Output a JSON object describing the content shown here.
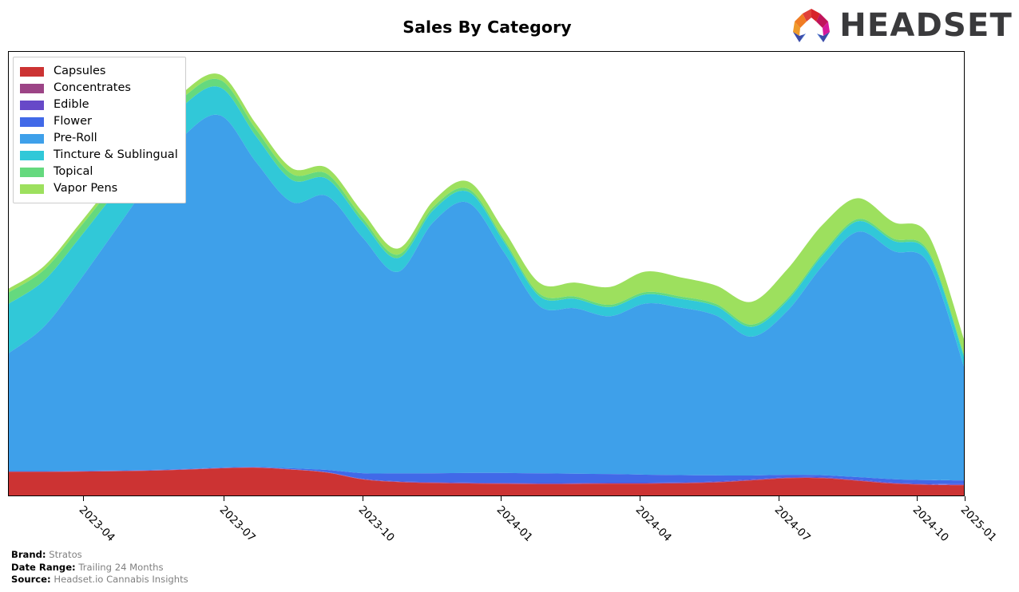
{
  "header": {
    "title": "Sales By Category",
    "logo_word": "HEADSET",
    "logo_colors": {
      "orange": "#f07c23",
      "red": "#d8232a",
      "crimson": "#c0145a",
      "magenta": "#d6189b",
      "indigo": "#3b4ba8",
      "blue": "#2b5fc4",
      "wordmark": "#3a3a3c"
    }
  },
  "legend": {
    "items": [
      {
        "label": "Capsules",
        "color": "#cc3333"
      },
      {
        "label": "Concentrates",
        "color": "#9c4486"
      },
      {
        "label": "Edible",
        "color": "#6749c8"
      },
      {
        "label": "Flower",
        "color": "#4169e8"
      },
      {
        "label": "Pre-Roll",
        "color": "#3ea0ea"
      },
      {
        "label": "Tincture & Sublingual",
        "color": "#31c8d8"
      },
      {
        "label": "Topical",
        "color": "#65d97e"
      },
      {
        "label": "Vapor Pens",
        "color": "#9de05e"
      }
    ]
  },
  "footer": {
    "rows": [
      {
        "key": "Brand:",
        "value": "Stratos"
      },
      {
        "key": "Date Range:",
        "value": "Trailing 24 Months"
      },
      {
        "key": "Source:",
        "value": "Headset.io Cannabis Insights"
      }
    ]
  },
  "chart_data": {
    "type": "area",
    "stacked": true,
    "title": "Sales By Category",
    "xlabel": "",
    "ylabel": "",
    "grid": false,
    "legend_position": "upper-left",
    "axis": {
      "y_visible": false,
      "y_ticklabels": [],
      "x_tick_labels": [
        "2023-04",
        "2023-07",
        "2023-10",
        "2024-01",
        "2024-04",
        "2024-07",
        "2024-10",
        "2025-01"
      ],
      "x_tick_fractions": [
        0.0787,
        0.2253,
        0.3703,
        0.5153,
        0.6603,
        0.8053,
        0.9503,
        1.0
      ]
    },
    "x": [
      "2023-01",
      "2023-02",
      "2023-03",
      "2023-04",
      "2023-05",
      "2023-06",
      "2023-07",
      "2023-08",
      "2023-09",
      "2023-10",
      "2023-11",
      "2023-12",
      "2024-01",
      "2024-02",
      "2024-03",
      "2024-04",
      "2024-05",
      "2024-06",
      "2024-07",
      "2024-08",
      "2024-09",
      "2024-10",
      "2024-11",
      "2024-12",
      "2025-01"
    ],
    "ylim": [
      0,
      100
    ],
    "series": [
      {
        "name": "Capsules",
        "color": "#cc3333",
        "values": [
          6.2,
          6.2,
          6.3,
          6.4,
          6.6,
          7.0,
          7.4,
          6.9,
          6.0,
          4.0,
          3.4,
          3.2,
          3.1,
          3.0,
          3.0,
          3.1,
          3.1,
          3.2,
          3.5,
          4.2,
          4.8,
          4.2,
          3.2,
          2.8,
          2.7
        ]
      },
      {
        "name": "Concentrates",
        "color": "#9c4486",
        "values": [
          0.05,
          0.05,
          0.05,
          0.05,
          0.05,
          0.05,
          0.05,
          0.05,
          0.05,
          0.05,
          0.05,
          0.05,
          0.05,
          0.05,
          0.05,
          0.05,
          0.05,
          0.05,
          0.05,
          0.05,
          0.05,
          0.05,
          0.05,
          0.05,
          0.05
        ]
      },
      {
        "name": "Edible",
        "color": "#6749c8",
        "values": [
          0.05,
          0.05,
          0.05,
          0.05,
          0.05,
          0.05,
          0.05,
          0.05,
          0.05,
          0.1,
          0.15,
          0.2,
          0.2,
          0.2,
          0.2,
          0.2,
          0.2,
          0.2,
          0.2,
          0.2,
          0.2,
          0.2,
          0.2,
          0.2,
          0.2
        ]
      },
      {
        "name": "Flower",
        "color": "#4169e8",
        "values": [
          0.1,
          0.1,
          0.1,
          0.1,
          0.1,
          0.1,
          0.1,
          0.2,
          0.6,
          1.6,
          2.2,
          2.4,
          2.6,
          2.6,
          2.5,
          2.3,
          2.1,
          1.9,
          1.5,
          0.8,
          0.5,
          0.6,
          0.9,
          1.0,
          1.0
        ]
      },
      {
        "name": "Pre-Roll",
        "color": "#3ea0ea",
        "values": [
          31.0,
          38.0,
          50.0,
          63.0,
          76.0,
          88.0,
          92.5,
          80.0,
          70.0,
          72.0,
          62.0,
          53.0,
          66.0,
          71.0,
          58.0,
          44.0,
          43.5,
          41.5,
          45.0,
          44.0,
          42.0,
          36.5,
          43.0,
          55.0,
          64.5,
          60.0,
          57.0,
          30.0
        ]
      },
      {
        "name": "Tincture & Sublingual",
        "color": "#31c8d8",
        "values": [
          13.0,
          12.0,
          11.0,
          9.5,
          8.5,
          7.5,
          7.0,
          6.0,
          4.5,
          4.0,
          3.5,
          3.0,
          2.8,
          2.6,
          2.5,
          2.4,
          2.4,
          2.3,
          2.5,
          2.6,
          2.8,
          2.8,
          2.7,
          2.6,
          2.6
        ]
      },
      {
        "name": "Topical",
        "color": "#65d97e",
        "values": [
          3.0,
          2.8,
          2.6,
          2.4,
          2.2,
          2.0,
          1.9,
          1.6,
          1.3,
          1.0,
          0.9,
          0.8,
          0.7,
          0.7,
          0.6,
          0.6,
          0.6,
          0.6,
          0.6,
          0.6,
          0.6,
          0.6,
          0.6,
          0.6,
          0.6
        ]
      },
      {
        "name": "Vapor Pens",
        "color": "#9de05e",
        "values": [
          1.0,
          1.0,
          1.1,
          1.2,
          1.3,
          1.4,
          1.4,
          1.5,
          1.6,
          1.6,
          1.6,
          1.6,
          2.2,
          2.6,
          3.4,
          4.6,
          5.4,
          5.0,
          4.8,
          6.6,
          8.5,
          6.0,
          4.4,
          4.2,
          4.0
        ]
      }
    ],
    "stack_totals_note": "Stacked totals peak near 2023-07 and decline through 2024 with secondary peaks at 2024-01 and 2024-08."
  }
}
